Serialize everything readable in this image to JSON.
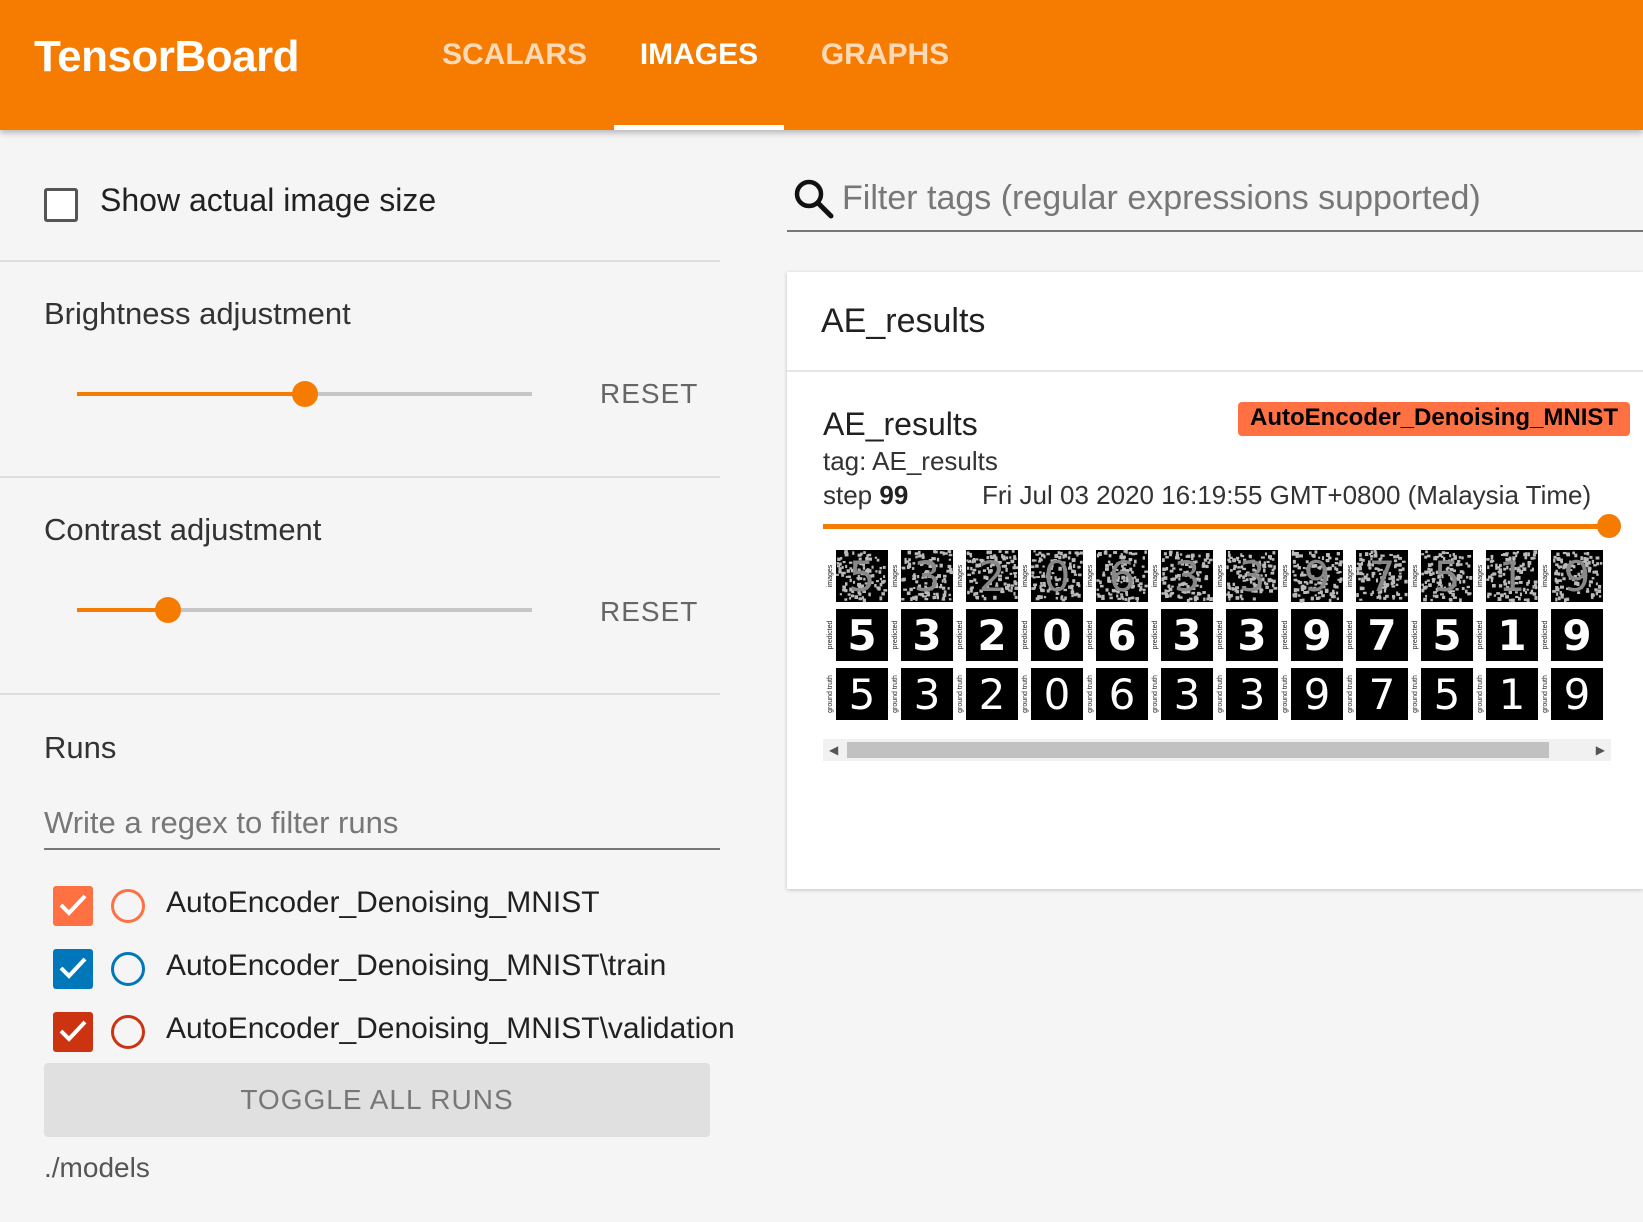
{
  "header": {
    "brand": "TensorBoard",
    "tabs": [
      {
        "label": "SCALARS",
        "active": false
      },
      {
        "label": "IMAGES",
        "active": true
      },
      {
        "label": "GRAPHS",
        "active": false
      }
    ],
    "accent_color": "#f57c00"
  },
  "sidebar": {
    "show_actual_size": {
      "label": "Show actual image size",
      "checked": false
    },
    "brightness": {
      "title": "Brightness adjustment",
      "value_fraction": 0.5,
      "reset_label": "RESET"
    },
    "contrast": {
      "title": "Contrast adjustment",
      "value_fraction": 0.2,
      "reset_label": "RESET"
    },
    "runs": {
      "title": "Runs",
      "filter_placeholder": "Write a regex to filter runs",
      "items": [
        {
          "label": "AutoEncoder_Denoising_MNIST",
          "checked": true,
          "color": "#ff7043"
        },
        {
          "label": "AutoEncoder_Denoising_MNIST\\train",
          "checked": true,
          "color": "#0077bb"
        },
        {
          "label": "AutoEncoder_Denoising_MNIST\\validation",
          "checked": true,
          "color": "#cc3311"
        }
      ],
      "toggle_all_label": "TOGGLE ALL RUNS",
      "logdir": "./models"
    }
  },
  "main": {
    "search_placeholder": "Filter tags (regular expressions supported)",
    "card": {
      "title": "AE_results",
      "image": {
        "name": "AE_results",
        "run_badge": "AutoEncoder_Denoising_MNIST",
        "tag_text": "tag: AE_results",
        "step_label": "step",
        "step_value": "99",
        "wall_time": "Fri Jul 03 2020 16:19:55 GMT+0800 (Malaysia Time)",
        "row_labels": [
          "images",
          "predicted",
          "ground truth"
        ],
        "digits": [
          "5",
          "3",
          "2",
          "0",
          "6",
          "3",
          "3",
          "9",
          "7",
          "5",
          "1",
          "9"
        ]
      }
    }
  }
}
